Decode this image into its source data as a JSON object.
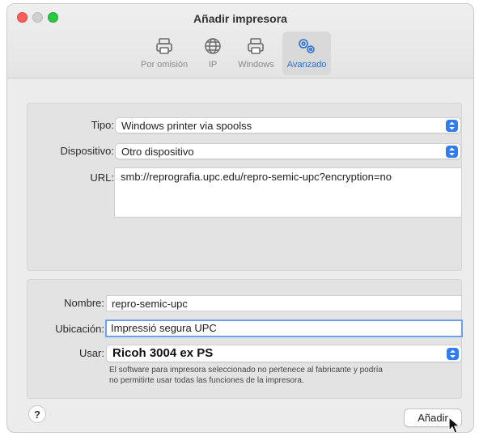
{
  "window": {
    "title": "Añadir impresora"
  },
  "tabs": [
    {
      "label": "Por omisión",
      "icon": "printer-icon",
      "active": false
    },
    {
      "label": "IP",
      "icon": "globe-icon",
      "active": false
    },
    {
      "label": "Windows",
      "icon": "printer-icon",
      "active": false
    },
    {
      "label": "Avanzado",
      "icon": "gears-icon",
      "active": true
    }
  ],
  "advanced": {
    "tipo_label": "Tipo:",
    "tipo_value": "Windows printer via spoolss",
    "dispositivo_label": "Dispositivo:",
    "dispositivo_value": "Otro dispositivo",
    "url_label": "URL:",
    "url_value": "smb://reprografia.upc.edu/repro-semic-upc?encryption=no"
  },
  "details": {
    "nombre_label": "Nombre:",
    "nombre_value": "repro-semic-upc",
    "ubicacion_label": "Ubicación:",
    "ubicacion_value": "Impressió segura UPC",
    "usar_label": "Usar:",
    "usar_value": "Ricoh 3004 ex PS",
    "note_line1": "El software para impresora seleccionado no pertenece al fabricante y podría",
    "note_line2": "no permitirte usar todas las funciones de la impresora."
  },
  "footer": {
    "help_label": "?",
    "add_label": "Añadir"
  },
  "colors": {
    "accent": "#2e7cf6",
    "close": "#ff5f57",
    "maximize": "#28c840"
  }
}
